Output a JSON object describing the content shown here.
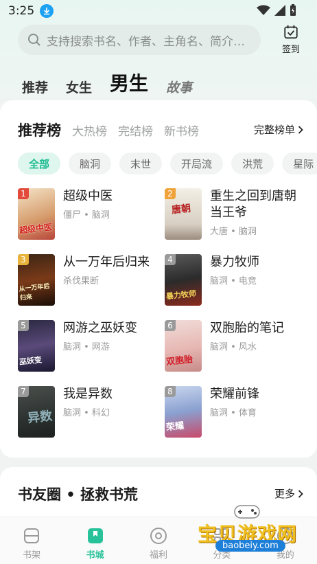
{
  "status": {
    "time": "3:25"
  },
  "search": {
    "placeholder": "支持搜索书名、作者、主角名、简介…"
  },
  "signin": {
    "label": "签到"
  },
  "top_tabs": [
    {
      "label": "推荐"
    },
    {
      "label": "女生"
    },
    {
      "label": "男生"
    },
    {
      "label": "故事"
    }
  ],
  "rank": {
    "tabs": [
      "推荐榜",
      "大热榜",
      "完结榜",
      "新书榜"
    ],
    "more": "完整榜单"
  },
  "chips": [
    "全部",
    "脑洞",
    "末世",
    "开局流",
    "洪荒",
    "星际"
  ],
  "books": [
    {
      "rank": "1",
      "title": "超级中医",
      "tags": "僵尸 • 脑洞",
      "cover_text": "超级中医"
    },
    {
      "rank": "2",
      "title": "重生之回到唐朝当王爷",
      "tags": "大唐 • 脑洞",
      "cover_text": "唐朝"
    },
    {
      "rank": "3",
      "title": "从一万年后归来",
      "tags": "杀伐果断",
      "cover_text": "从一万年后归来"
    },
    {
      "rank": "4",
      "title": "暴力牧师",
      "tags": "脑洞 • 电竞",
      "cover_text": "暴力牧师"
    },
    {
      "rank": "5",
      "title": "网游之巫妖变",
      "tags": "脑洞 • 网游",
      "cover_text": "巫妖变"
    },
    {
      "rank": "6",
      "title": "双胞胎的笔记",
      "tags": "脑洞 • 风水",
      "cover_text": "双胞胎"
    },
    {
      "rank": "7",
      "title": "我是异数",
      "tags": "脑洞 • 科幻",
      "cover_text": "异数"
    },
    {
      "rank": "8",
      "title": "荣耀前锋",
      "tags": "脑洞 • 体育",
      "cover_text": "荣耀"
    }
  ],
  "circle": {
    "title": "书友圈 • 拯救书荒",
    "more": "更多"
  },
  "nav": [
    {
      "label": "书架"
    },
    {
      "label": "书城"
    },
    {
      "label": "福利"
    },
    {
      "label": "分类"
    },
    {
      "label": "我的"
    }
  ],
  "watermark": {
    "text": "宝贝游戏网",
    "url": "baobeiy.com"
  },
  "colors": {
    "accent": "#27c29a",
    "rank_badge": "#e8a33a"
  }
}
